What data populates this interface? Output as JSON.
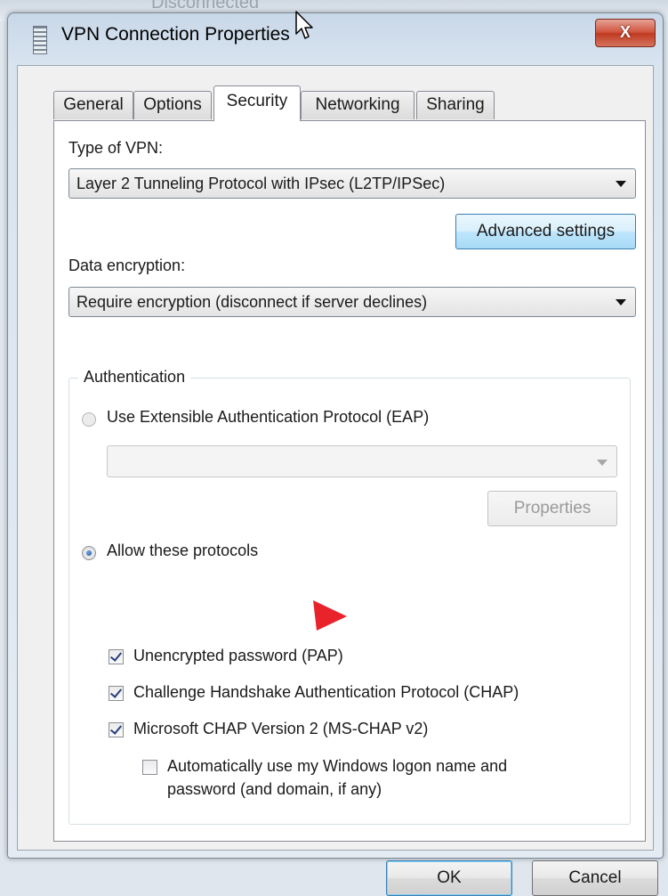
{
  "background": {
    "text": "Disconnected"
  },
  "window": {
    "title": "VPN Connection Properties",
    "close_glyph": "X"
  },
  "tabs": [
    {
      "label": "General",
      "active": false
    },
    {
      "label": "Options",
      "active": false
    },
    {
      "label": "Security",
      "active": true
    },
    {
      "label": "Networking",
      "active": false
    },
    {
      "label": "Sharing",
      "active": false
    }
  ],
  "security": {
    "vpn_type_label": "Type of VPN:",
    "vpn_type_value": "Layer 2 Tunneling Protocol with IPsec (L2TP/IPSec)",
    "advanced_settings_label": "Advanced settings",
    "data_encryption_label": "Data encryption:",
    "data_encryption_value": "Require encryption (disconnect if server declines)",
    "authentication": {
      "group_title": "Authentication",
      "eap_label": "Use Extensible Authentication Protocol (EAP)",
      "eap_selected": false,
      "eap_value": "",
      "properties_label": "Properties",
      "allow_label": "Allow these protocols",
      "allow_selected": true,
      "protocols": [
        {
          "label": "Unencrypted password (PAP)",
          "checked": true
        },
        {
          "label": "Challenge Handshake Authentication Protocol (CHAP)",
          "checked": true
        },
        {
          "label": "Microsoft CHAP Version 2 (MS-CHAP v2)",
          "checked": true
        }
      ],
      "auto_logon_line1": "Automatically use my Windows logon name and",
      "auto_logon_line2": "password (and domain, if any)",
      "auto_logon_checked": false
    }
  },
  "footer": {
    "ok_label": "OK",
    "cancel_label": "Cancel"
  },
  "colors": {
    "accent_button": "#bee6fd",
    "close_button": "#c0391f",
    "annotation_pointer": "#e8232b"
  },
  "icons": {
    "title_icon": "vpn-connection-icon",
    "mouse_cursor": "mouse-cursor-icon",
    "annotation": "red-pointer-icon"
  }
}
